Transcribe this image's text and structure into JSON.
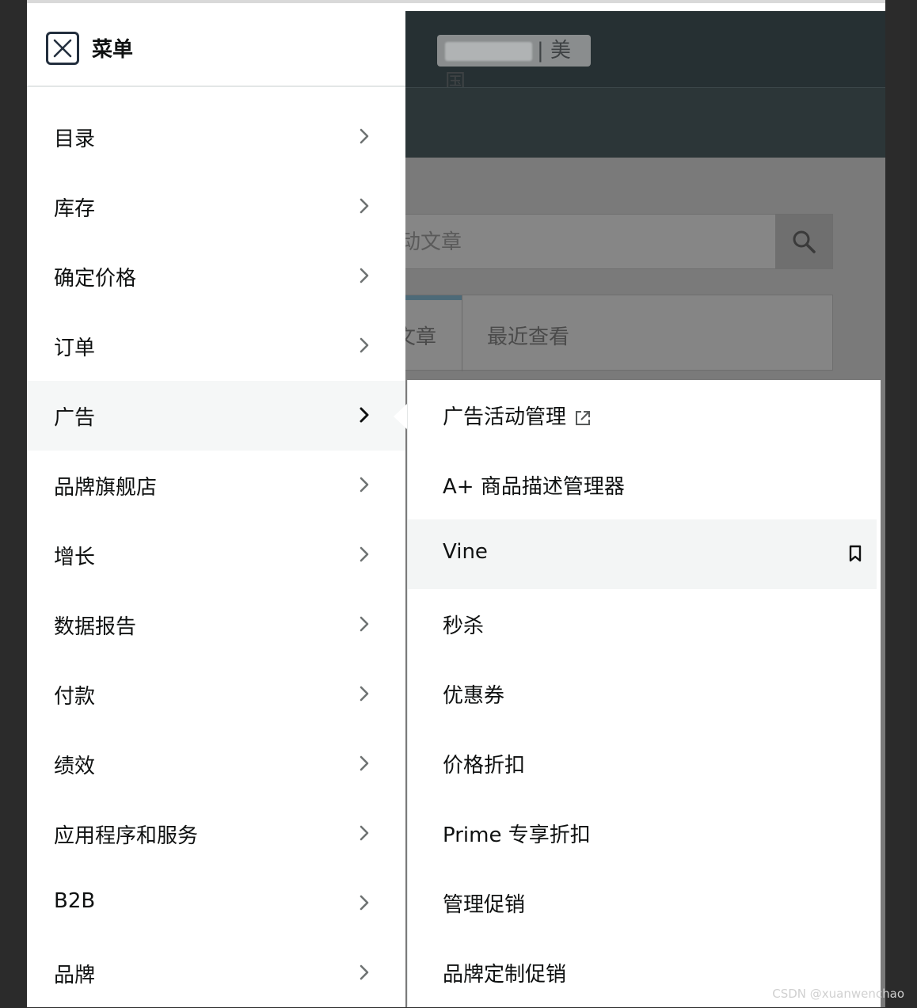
{
  "background": {
    "store_text": "| 美国",
    "search_placeholder": "动文章",
    "tabs": [
      "文章",
      "最近查看"
    ]
  },
  "menu": {
    "title": "菜单",
    "items": [
      {
        "label": "目录"
      },
      {
        "label": "库存"
      },
      {
        "label": "确定价格"
      },
      {
        "label": "订单"
      },
      {
        "label": "广告",
        "active": true
      },
      {
        "label": "品牌旗舰店"
      },
      {
        "label": "增长"
      },
      {
        "label": "数据报告"
      },
      {
        "label": "付款"
      },
      {
        "label": "绩效"
      },
      {
        "label": "应用程序和服务"
      },
      {
        "label": "B2B"
      },
      {
        "label": "品牌"
      }
    ]
  },
  "submenu": {
    "items": [
      {
        "label": "广告活动管理",
        "icon": "external-link-icon"
      },
      {
        "label": "A+ 商品描述管理器"
      },
      {
        "label": "Vine",
        "icon": "bookmark-icon",
        "highlight": true
      },
      {
        "label": "秒杀"
      },
      {
        "label": "优惠券"
      },
      {
        "label": "价格折扣"
      },
      {
        "label": "Prime 专享折扣"
      },
      {
        "label": "管理促销"
      },
      {
        "label": "品牌定制促销"
      }
    ]
  },
  "watermark": "CSDN @xuanwenchao"
}
